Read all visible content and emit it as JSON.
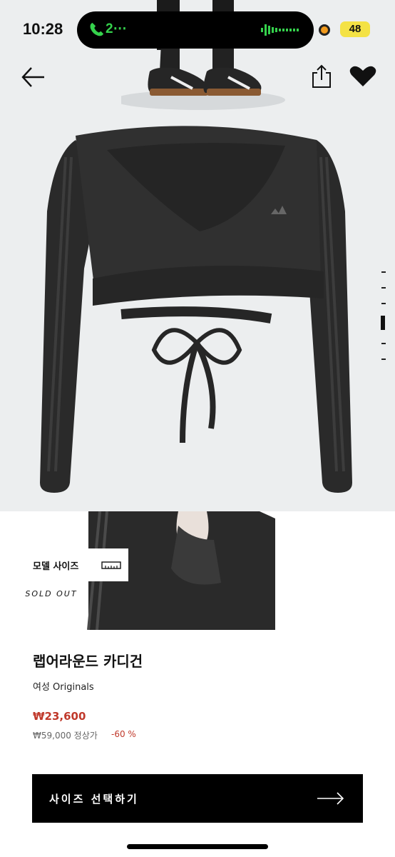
{
  "status": {
    "time": "10:28",
    "call_label": "2⋯",
    "battery": "48"
  },
  "gallery": {
    "pages_total": 6,
    "active_page_index": 3
  },
  "overlays": {
    "model_size_label": "모델 사이즈",
    "sold_out_label": "SOLD OUT"
  },
  "product": {
    "title": "랩어라운드 카디건",
    "subtitle": "여성 Originals",
    "sale_price": "₩23,600",
    "original_price": "₩59,000 정상가",
    "discount": "-60 %"
  },
  "cta": {
    "label": "사이즈 선택하기"
  },
  "icons": {
    "back": "arrow-left-icon",
    "share": "share-icon",
    "wishlist": "heart-icon",
    "ruler": "ruler-icon",
    "cta_arrow": "arrow-right-icon"
  },
  "colors": {
    "price_red": "#c0392b",
    "cta_background": "#000000",
    "island_green": "#35d14c",
    "battery_yellow": "#f4e245"
  }
}
